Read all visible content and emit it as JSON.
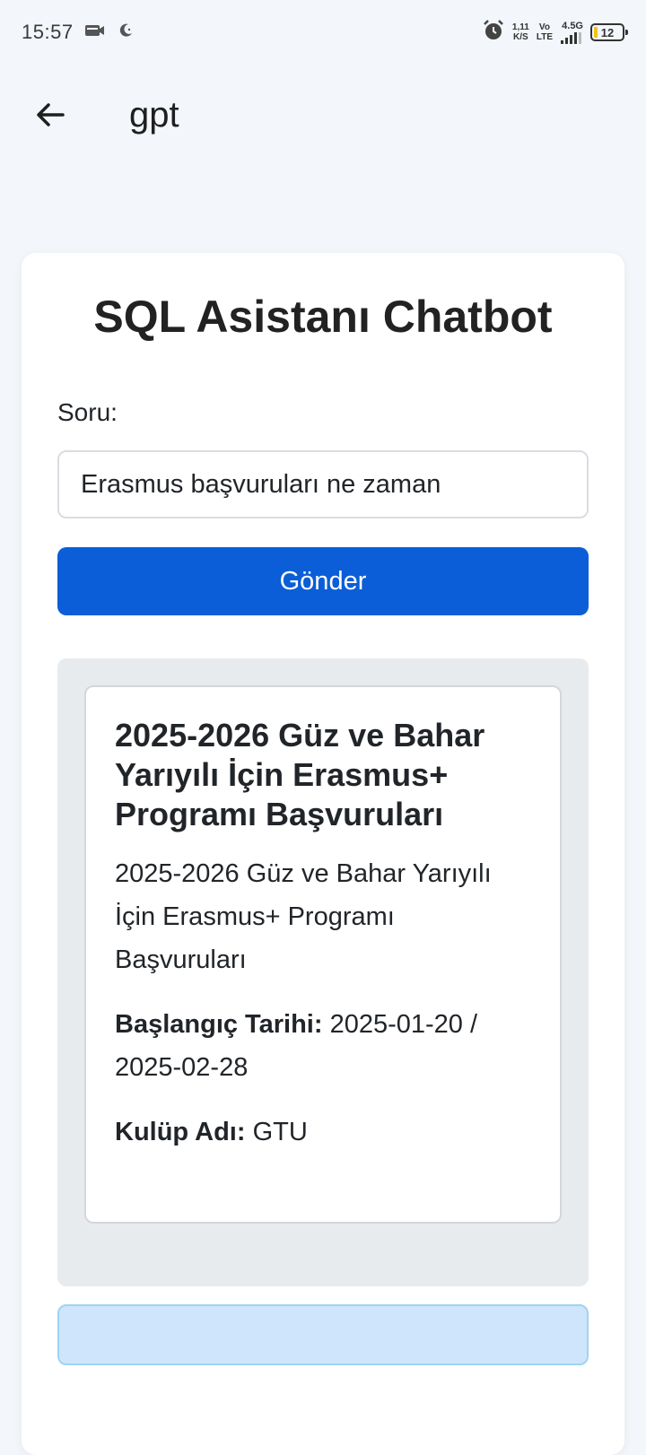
{
  "status_bar": {
    "time": "15:57",
    "speed_value": "1,11",
    "speed_unit": "K/S",
    "volte": "Vo",
    "lte": "LTE",
    "network": "4.5G",
    "battery": "12"
  },
  "app_bar": {
    "title": "gpt"
  },
  "page": {
    "title": "SQL Asistanı Chatbot",
    "question_label": "Soru:",
    "question_value": "Erasmus başvuruları ne zaman",
    "send_label": "Gönder"
  },
  "result": {
    "title": "2025-2026 Güz ve Bahar Yarıyılı İçin Erasmus+ Programı Başvuruları",
    "description": "2025-2026 Güz ve Bahar Yarıyılı İçin Erasmus+ Programı Başvuruları",
    "start_label": "Başlangıç Tarihi:",
    "start_value": "2025-01-20 / 2025-02-28",
    "club_label": "Kulüp Adı:",
    "club_value": "GTU"
  },
  "colors": {
    "primary": "#0b5ed7",
    "info_bg": "#cfe5fb",
    "response_bg": "#e8ebee"
  }
}
